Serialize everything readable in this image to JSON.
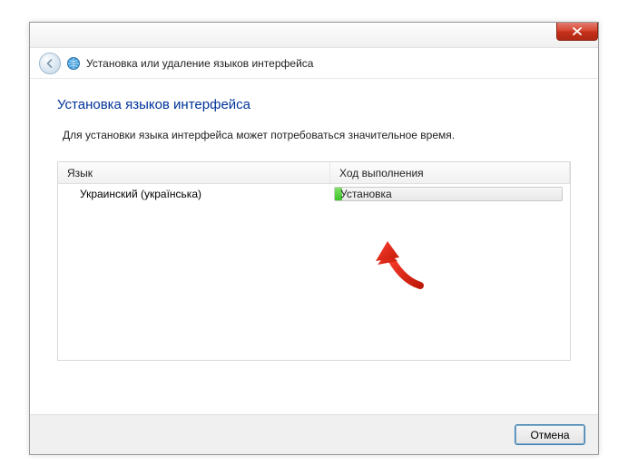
{
  "header": {
    "breadcrumb": "Установка или удаление языков интерфейса"
  },
  "content": {
    "heading": "Установка языков интерфейса",
    "description": "Для установки языка интерфейса может потребоваться значительное время."
  },
  "table": {
    "columns": {
      "language": "Язык",
      "progress": "Ход выполнения"
    },
    "rows": [
      {
        "language": "Украинский (українська)",
        "status": "Установка"
      }
    ]
  },
  "footer": {
    "cancel": "Отмена"
  }
}
